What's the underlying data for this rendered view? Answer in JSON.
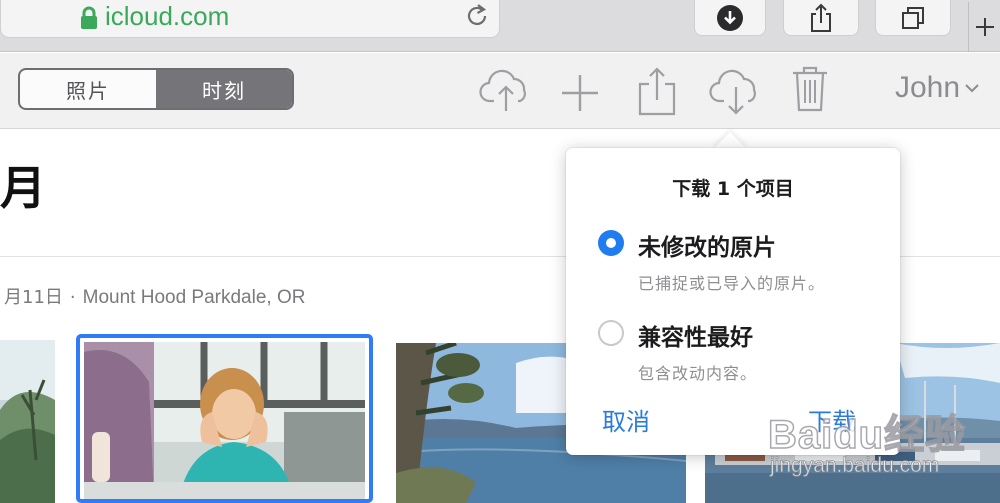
{
  "browser": {
    "url": "icloud.com",
    "icons": [
      "lock-icon",
      "reload-icon",
      "download-icon",
      "share-icon",
      "tabs-icon",
      "plus-icon"
    ]
  },
  "toolbar": {
    "segments": [
      "照片",
      "时刻"
    ],
    "selected_segment": "时刻",
    "icons": [
      "cloud-upload-icon",
      "plus-icon",
      "share-icon",
      "cloud-download-icon",
      "trash-icon"
    ],
    "user_name": "John",
    "user_chevron": "⌄"
  },
  "content": {
    "month_title": "月",
    "moment_date": "月11日",
    "moment_separator": "·",
    "moment_location": "Mount Hood Parkdale, OR"
  },
  "popover": {
    "title": "下载 1 个项目",
    "options": [
      {
        "label": "未修改的原片",
        "description": "已捕捉或已导入的原片。",
        "selected": true
      },
      {
        "label": "兼容性最好",
        "description": "包含改动内容。",
        "selected": false
      }
    ],
    "cancel_label": "取消",
    "download_label": "下载"
  },
  "watermark": {
    "brand": "Baidu经验",
    "url": "jingyan.baidu.com"
  },
  "colors": {
    "accent": "#1f7cf1",
    "url_green": "#3aa95a",
    "selection_border": "#2f7cf6",
    "segment_selected": "#757579"
  }
}
